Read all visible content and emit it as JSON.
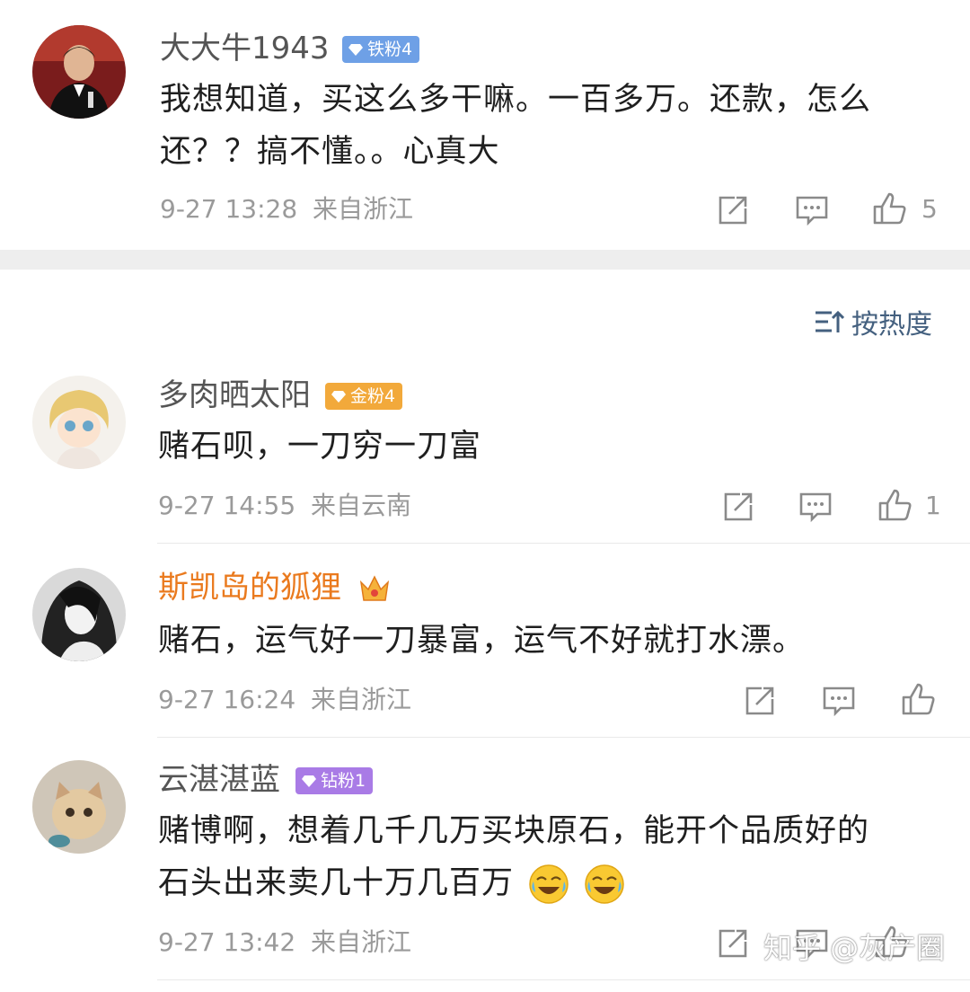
{
  "comments": [
    {
      "user": "大大牛1943",
      "badge": "铁粉4",
      "badge_color": "#6ea0e6",
      "text_lines": [
        "我想知道，买这么多干嘛。一百多万。还款，怎么",
        "还？？搞不懂。。心真大"
      ],
      "time": "9-27 13:28",
      "location": "来自浙江",
      "likes": "5"
    },
    {
      "user": "多肉晒太阳",
      "badge": "金粉4",
      "badge_color": "#f2a93b",
      "text_lines": [
        "赌石呗，一刀穷一刀富"
      ],
      "time": "9-27 14:55",
      "location": "来自云南",
      "likes": "1"
    },
    {
      "user": "斯凯岛的狐狸",
      "badge": "",
      "vip_crown": true,
      "text_lines": [
        "赌石，运气好一刀暴富，运气不好就打水漂。"
      ],
      "time": "9-27 16:24",
      "location": "来自浙江",
      "likes": ""
    },
    {
      "user": "云湛湛蓝",
      "badge": "钻粉1",
      "badge_color": "#a97be6",
      "text_lines": [
        "赌博啊，想着几千几万买块原石，能开个品质好的",
        "石头出来卖几十万几百万"
      ],
      "emoji": [
        "laugh-cry-icon",
        "laugh-cry-icon"
      ],
      "time": "9-27 13:42",
      "location": "来自浙江",
      "likes": ""
    }
  ],
  "sort_label": "按热度",
  "watermark": "知乎 @灰产圈"
}
